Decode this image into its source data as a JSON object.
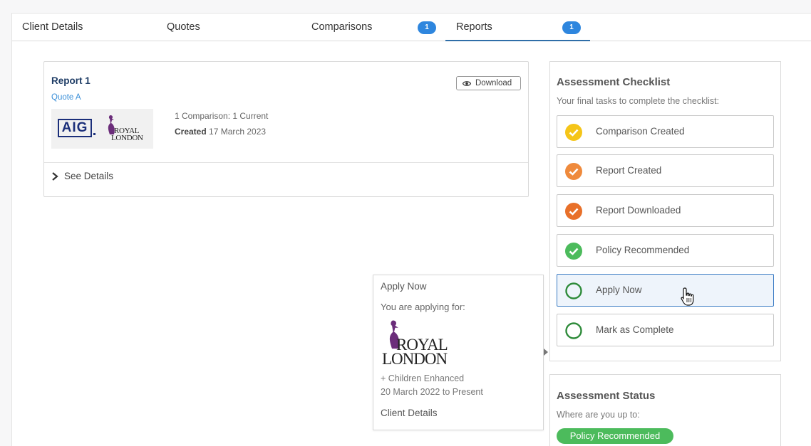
{
  "tabs": [
    {
      "label": "Client Details",
      "active": false
    },
    {
      "label": "Quotes",
      "active": false
    },
    {
      "label": "Comparisons",
      "badge": "1",
      "active": false
    },
    {
      "label": "Reports",
      "badge": "1",
      "active": true
    }
  ],
  "report": {
    "title": "Report 1",
    "quote": "Quote A",
    "download_label": "Download",
    "comparisons": "1 Comparison: 1 Current",
    "created_label": "Created",
    "created_date": "17 March 2023",
    "see_details": "See Details",
    "providers": [
      {
        "name": "AIG",
        "logo_text": "AIG"
      },
      {
        "name": "Royal London",
        "logo_line1": "ROYAL",
        "logo_line2": "LONDON"
      }
    ]
  },
  "apply_popover": {
    "title": "Apply Now",
    "subtitle": "You are applying for:",
    "provider_line1": "ROYAL",
    "provider_line2": "LONDON",
    "product": "+ Children Enhanced",
    "period": "20 March 2022 to Present",
    "link": "Client Details"
  },
  "checklist": {
    "title": "Assessment Checklist",
    "subtitle": "Your final tasks to complete the checklist:",
    "items": [
      {
        "label": "Comparison Created",
        "state": "done",
        "color": "#f5c518"
      },
      {
        "label": "Report Created",
        "state": "done",
        "color": "#ef8a3c"
      },
      {
        "label": "Report Downloaded",
        "state": "done",
        "color": "#e8702a"
      },
      {
        "label": "Policy Recommended",
        "state": "done",
        "color": "#4cbb5c"
      },
      {
        "label": "Apply Now",
        "state": "pending",
        "color": "#2e8b3a"
      },
      {
        "label": "Mark as Complete",
        "state": "pending",
        "color": "#2e8b3a"
      }
    ]
  },
  "status": {
    "title": "Assessment Status",
    "subtitle": "Where are you up to:",
    "value": "Policy Recommended",
    "color": "#4cbb5c"
  },
  "colors": {
    "accent": "#2e86de",
    "brand_navy": "#1f3d66",
    "link": "#3a8fd8",
    "royal_purple": "#6b2d7a"
  }
}
